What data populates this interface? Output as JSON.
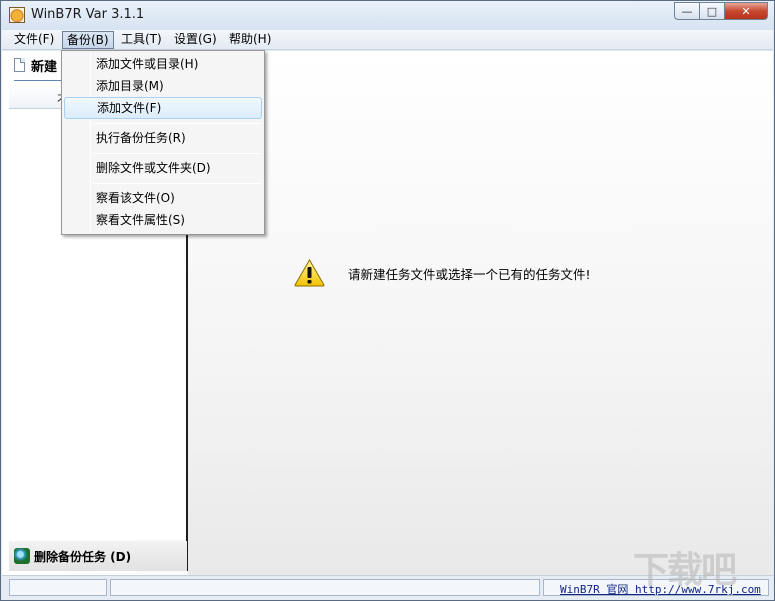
{
  "window": {
    "title": "WinB7R Var 3.1.1",
    "caption_minimize": "—",
    "caption_maximize": "□",
    "caption_close": "✕"
  },
  "menubar": {
    "items": [
      "文件(F)",
      "备份(B)",
      "工具(T)",
      "设置(G)",
      "帮助(H)"
    ],
    "open_index": 1
  },
  "backup_menu": {
    "items": [
      "添加文件或目录(H)",
      "添加目录(M)",
      "添加文件(F)",
      "执行备份任务(R)",
      "删除文件或文件夹(D)",
      "察看该文件(O)",
      "察看文件属性(S)"
    ],
    "highlighted_index": 2
  },
  "left_panel": {
    "new_task_label": "新建",
    "tab_label": "才",
    "delete_task_label": "删除备份任务 (D)"
  },
  "main": {
    "message": "请新建任务文件或选择一个已有的任务文件!"
  },
  "statusbar": {
    "link_text": "WinB7R 官网 http://www.7rkj.com"
  },
  "watermark": "下载吧",
  "colors": {
    "menu_highlight": "#dbecfb",
    "title_gradient_top": "#e9f1fa",
    "link": "#10248a"
  }
}
